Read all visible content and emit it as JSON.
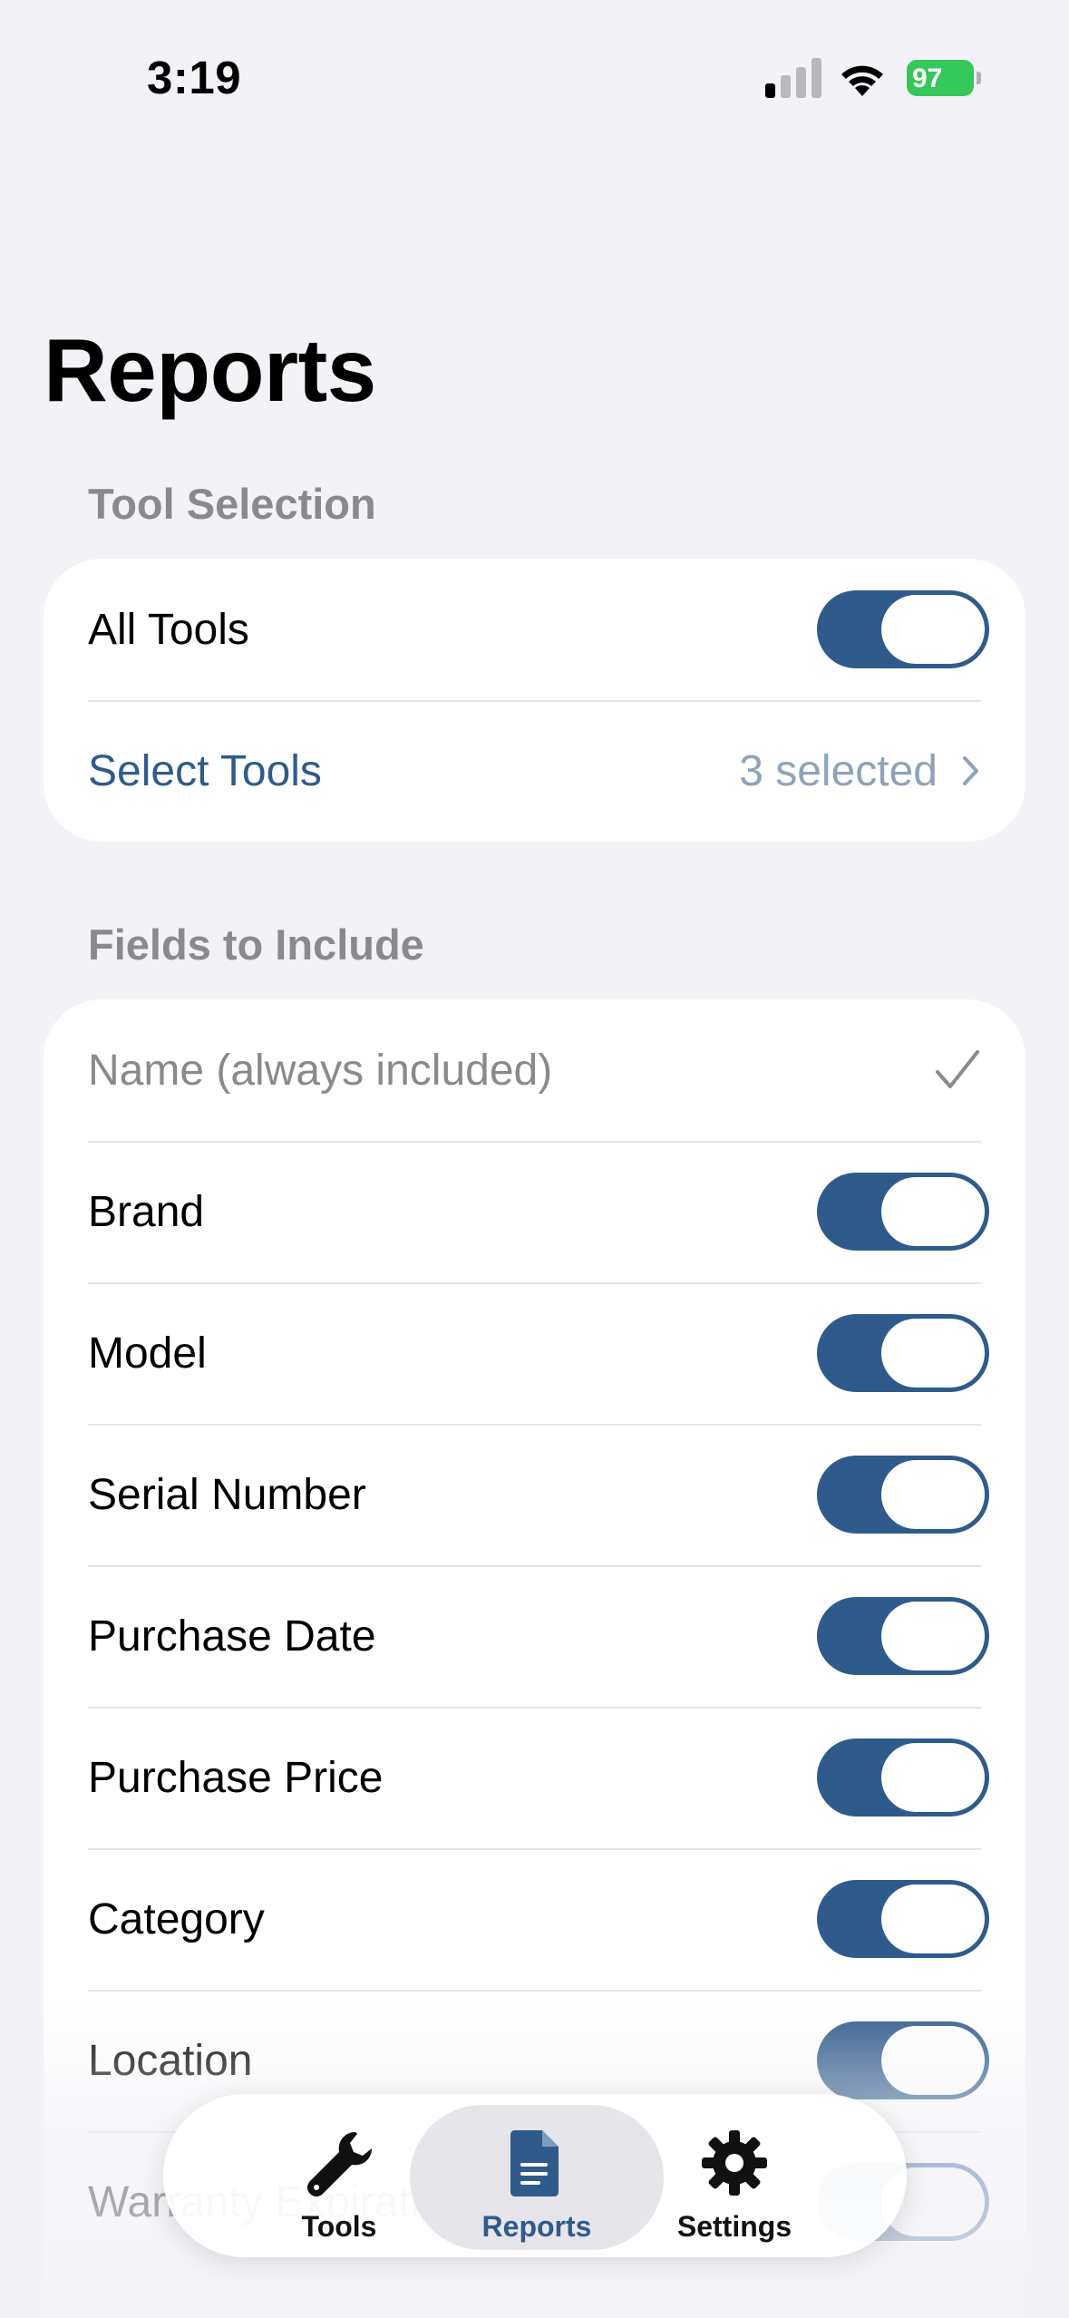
{
  "status_bar": {
    "time": "3:19",
    "battery": "97"
  },
  "title": "Reports",
  "tool_selection": {
    "header": "Tool Selection",
    "all_tools_label": "All Tools",
    "select_tools_label": "Select Tools",
    "selected_count": "3 selected"
  },
  "fields": {
    "header": "Fields to Include",
    "name_label": "Name (always included)",
    "items": [
      {
        "label": "Brand",
        "on": true
      },
      {
        "label": "Model",
        "on": true
      },
      {
        "label": "Serial Number",
        "on": true
      },
      {
        "label": "Purchase Date",
        "on": true
      },
      {
        "label": "Purchase Price",
        "on": true
      },
      {
        "label": "Category",
        "on": true
      },
      {
        "label": "Location",
        "on": true
      },
      {
        "label": "Warranty Expiration",
        "on": true
      }
    ]
  },
  "tab_bar": {
    "tabs": [
      {
        "label": "Tools",
        "icon": "wrench-icon"
      },
      {
        "label": "Reports",
        "icon": "document-icon",
        "active": true
      },
      {
        "label": "Settings",
        "icon": "gear-icon"
      }
    ]
  },
  "colors": {
    "accent": "#2f5b8c",
    "background": "#f2f2f7",
    "battery": "#34c759"
  }
}
